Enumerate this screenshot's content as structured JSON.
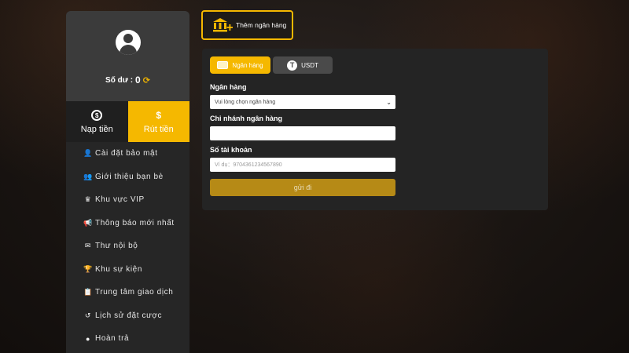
{
  "sidebar": {
    "balance_label": "Số dư :",
    "balance_value": "0",
    "deposit_label": "Nạp tiền",
    "withdraw_label": "Rút tiền",
    "items": [
      {
        "label": "Cài đặt bảo mật",
        "icon": "user-lock-icon"
      },
      {
        "label": "Giới thiệu bạn bè",
        "icon": "users-icon"
      },
      {
        "label": "Khu vực VIP",
        "icon": "crown-icon"
      },
      {
        "label": "Thông báo mới nhất",
        "icon": "megaphone-icon"
      },
      {
        "label": "Thư nội bộ",
        "icon": "mail-icon"
      },
      {
        "label": "Khu sự kiện",
        "icon": "trophy-icon"
      },
      {
        "label": "Trung tâm giao dịch",
        "icon": "clipboard-icon"
      },
      {
        "label": "Lịch sử đặt cược",
        "icon": "history-icon"
      },
      {
        "label": "Hoàn trả",
        "icon": "coin-icon"
      }
    ]
  },
  "add_bank": {
    "label": "Thêm ngân hàng"
  },
  "panel": {
    "tab_bank": "Ngân hàng",
    "tab_usdt": "USDT",
    "bank_label": "Ngân hàng",
    "bank_select": "Vui lòng chọn ngân hàng",
    "branch_label": "Chi nhánh ngân hàng",
    "branch_value": "",
    "account_label": "Số tài khoản",
    "account_placeholder": "Ví dụ：9704361234567890",
    "submit_label": "gửi đi"
  },
  "colors": {
    "accent": "#f5b800",
    "panel": "#242424",
    "sidebar": "#262626"
  }
}
